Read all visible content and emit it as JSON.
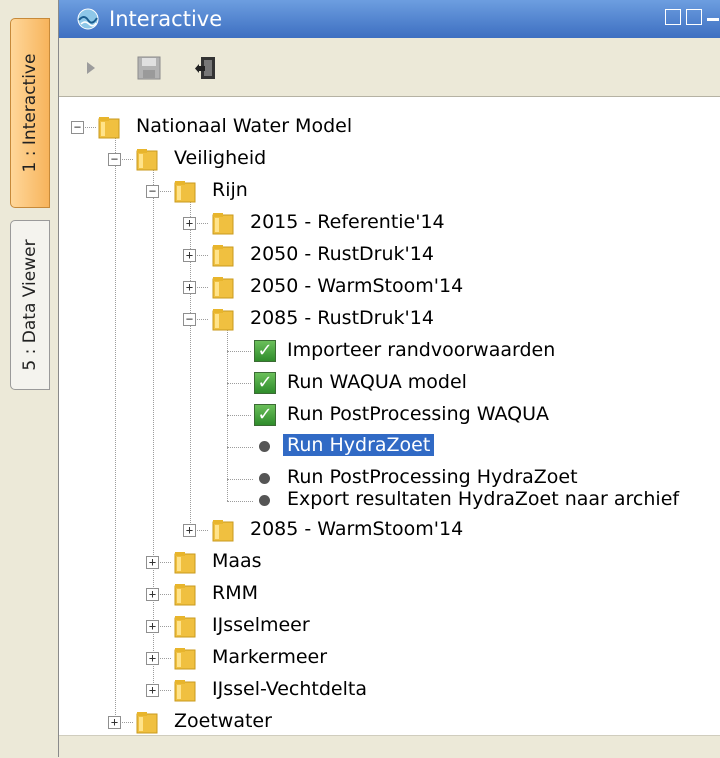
{
  "tabs": [
    {
      "label": "1 : Interactive"
    },
    {
      "label": "5 : Data Viewer"
    }
  ],
  "panel": {
    "title": "Interactive"
  },
  "toolbar": {
    "run_icon": "play-icon",
    "save_icon": "save-icon",
    "exit_icon": "exit-door-icon"
  },
  "tree": {
    "root": "Nationaal Water Model",
    "veiligheid": "Veiligheid",
    "rijn": "Rijn",
    "s1": "2015 - Referentie'14",
    "s2": "2050 - RustDruk'14",
    "s3": "2050 - WarmStoom'14",
    "s4": "2085 - RustDruk'14",
    "t1": "Importeer randvoorwaarden",
    "t2": "Run WAQUA model",
    "t3": "Run PostProcessing WAQUA",
    "t4": "Run HydraZoet",
    "t5": "Run PostProcessing HydraZoet",
    "t6": "Export resultaten HydraZoet naar archief",
    "s5": "2085 - WarmStoom'14",
    "maas": "Maas",
    "rmm": "RMM",
    "ijsselmeer": "IJsselmeer",
    "markermeer": "Markermeer",
    "ijssel_vechtdelta": "IJssel-Vechtdelta",
    "zoetwater": "Zoetwater"
  },
  "colors": {
    "titlebar": "#3d6fc1",
    "selection": "#316ac5",
    "active_tab": "#f7b45c",
    "folder": "#f0c040",
    "check": "#2f8c2b"
  }
}
